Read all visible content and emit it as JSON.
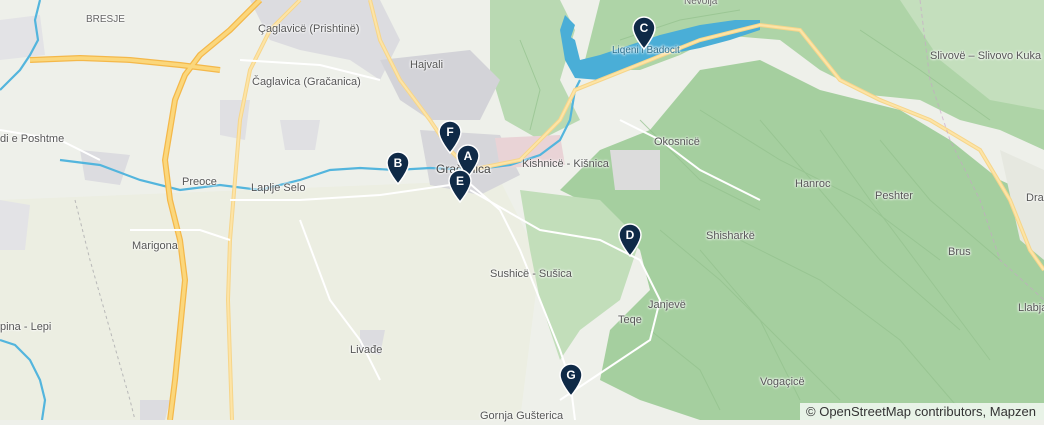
{
  "map": {
    "places": [
      {
        "id": "bresje",
        "name": "BRESJE"
      },
      {
        "id": "caglavica-prishtine",
        "name": "Çaglavicë (Prishtinë)"
      },
      {
        "id": "hajvali",
        "name": "Hajvali"
      },
      {
        "id": "caglavica-gracanica",
        "name": "Čaglavica (Gračanica)"
      },
      {
        "id": "di-e-poshtme",
        "name": "di e Poshtme"
      },
      {
        "id": "preoce",
        "name": "Preoce"
      },
      {
        "id": "laplje-selo",
        "name": "Laplje Selo"
      },
      {
        "id": "marigona",
        "name": "Marigona"
      },
      {
        "id": "gracanica",
        "name": "Gračanica"
      },
      {
        "id": "kishnice",
        "name": "Kishnicë - Kišnica"
      },
      {
        "id": "okosnice",
        "name": "Okosnicë"
      },
      {
        "id": "hanroc",
        "name": "Hanroc"
      },
      {
        "id": "peshter",
        "name": "Peshter"
      },
      {
        "id": "shisharke",
        "name": "Shisharkë"
      },
      {
        "id": "sushice",
        "name": "Sushicë - Sušica"
      },
      {
        "id": "janjeve",
        "name": "Janjevë"
      },
      {
        "id": "teqe",
        "name": "Teqe"
      },
      {
        "id": "brus",
        "name": "Brus"
      },
      {
        "id": "slivove",
        "name": "Slivovë – Slivovo"
      },
      {
        "id": "livade",
        "name": "Livađe"
      },
      {
        "id": "lepi",
        "name": "pina - Lepi"
      },
      {
        "id": "vogacice",
        "name": "Vogaçicë"
      },
      {
        "id": "gornja-gusterica",
        "name": "Gornja Gušterica"
      },
      {
        "id": "dra",
        "name": "Dra"
      },
      {
        "id": "kuka",
        "name": "Kuka"
      },
      {
        "id": "llabja",
        "name": "Llabja"
      },
      {
        "id": "nevolja",
        "name": "Nevolja"
      }
    ],
    "water_labels": [
      {
        "id": "liqeni-badocit",
        "name": "Liqeni i Badocit"
      }
    ],
    "markers": [
      {
        "id": "A",
        "label": "A"
      },
      {
        "id": "B",
        "label": "B"
      },
      {
        "id": "C",
        "label": "C"
      },
      {
        "id": "D",
        "label": "D"
      },
      {
        "id": "E",
        "label": "E"
      },
      {
        "id": "F",
        "label": "F"
      },
      {
        "id": "G",
        "label": "G"
      }
    ],
    "attribution": "© OpenStreetMap contributors, Mapzen"
  },
  "colors": {
    "land": "#eef0ea",
    "forest": "#a8d0a4",
    "urban": "#d6d6da",
    "water": "#4aaed7",
    "motorway": "#f7c45a",
    "road": "#ffffff",
    "marker": "#0f2a47"
  }
}
